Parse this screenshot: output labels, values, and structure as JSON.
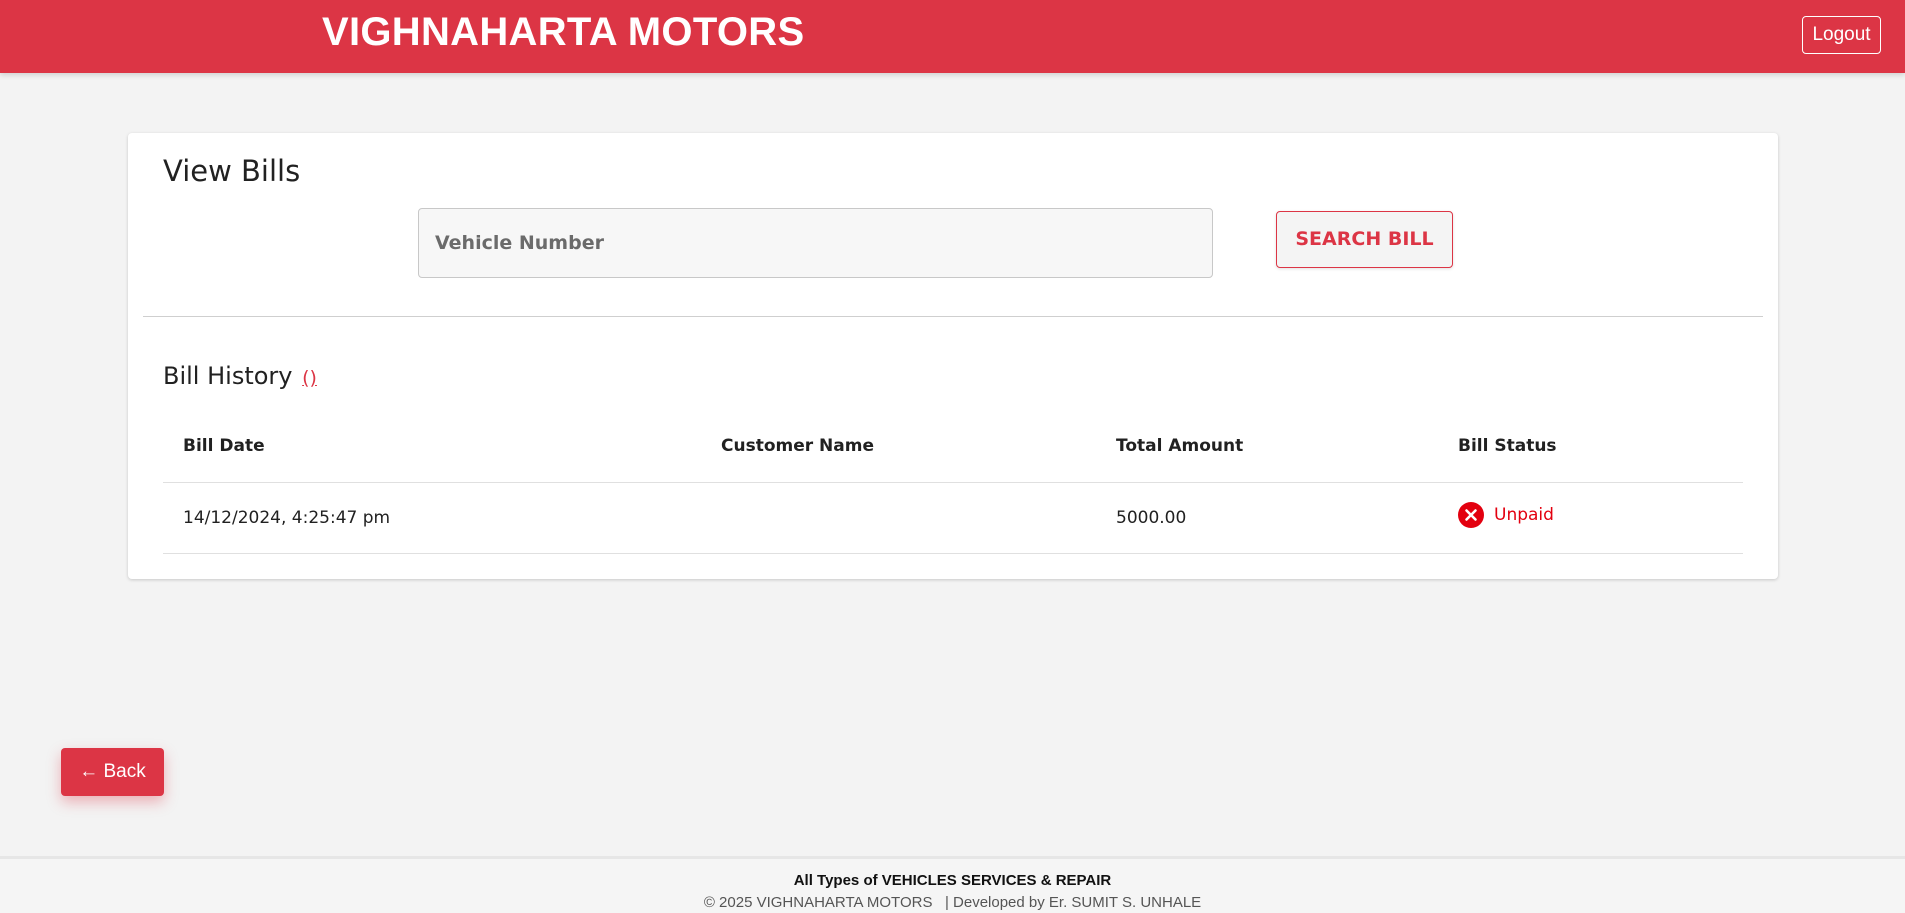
{
  "header": {
    "brand": "VIGHNAHARTA MOTORS",
    "logout_label": "Logout",
    "accent_color": "#dc3545"
  },
  "view_bills": {
    "title": "View Bills",
    "search": {
      "placeholder": "Vehicle Number",
      "value": ""
    },
    "search_button_label": "SEARCH BILL"
  },
  "bill_history": {
    "title": "Bill History",
    "count_label": "()",
    "columns": [
      "Bill Date",
      "Customer Name",
      "Total Amount",
      "Bill Status"
    ],
    "rows": [
      {
        "bill_date": "14/12/2024, 4:25:47 pm",
        "customer_name": "",
        "total_amount": "5000.00",
        "bill_status": "Unpaid",
        "status_icon": "x-circle-icon",
        "status_color": "#e3000f"
      }
    ]
  },
  "back_button_label": "← Back",
  "footer": {
    "tagline": "All Types of VEHICLES SERVICES & REPAIR",
    "copyright": "© 2025 VIGHNAHARTA MOTORS   | Developed by Er. SUMIT S. UNHALE"
  }
}
